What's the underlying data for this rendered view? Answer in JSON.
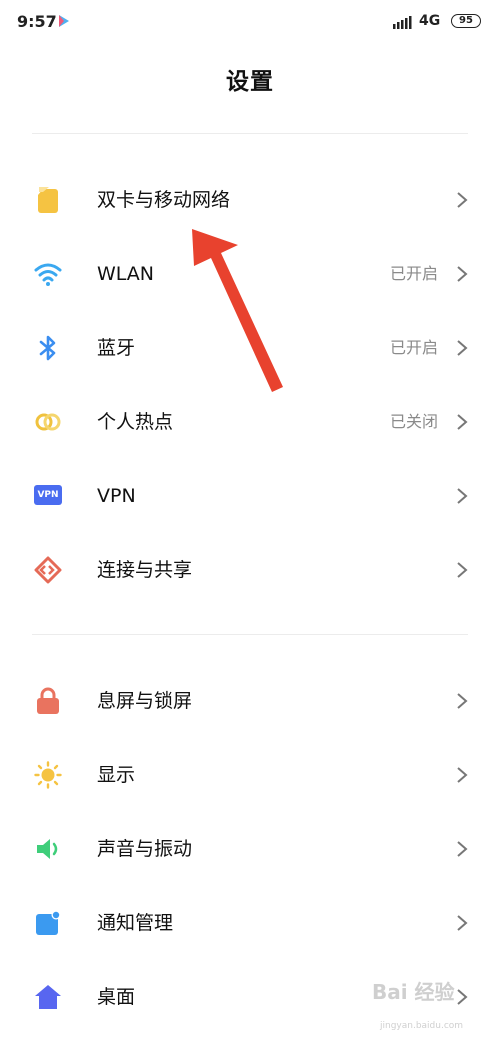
{
  "status_bar": {
    "time": "9:57",
    "network": "4G",
    "battery": "95"
  },
  "page_title": "设置",
  "section1": [
    {
      "label": "双卡与移动网络",
      "value": "",
      "icon": "sim-card-icon",
      "color": "#f5c342"
    },
    {
      "label": "WLAN",
      "value": "已开启",
      "icon": "wifi-icon",
      "color": "#3aa8f0"
    },
    {
      "label": "蓝牙",
      "value": "已开启",
      "icon": "bluetooth-icon",
      "color": "#3b8ef0"
    },
    {
      "label": "个人热点",
      "value": "已关闭",
      "icon": "hotspot-icon",
      "color": "#f0c23e"
    },
    {
      "label": "VPN",
      "value": "",
      "icon": "vpn-icon",
      "color": "#4a6cf0"
    },
    {
      "label": "连接与共享",
      "value": "",
      "icon": "connection-share-icon",
      "color": "#e56a57"
    }
  ],
  "section2": [
    {
      "label": "息屏与锁屏",
      "value": "",
      "icon": "lock-icon",
      "color": "#e9735f"
    },
    {
      "label": "显示",
      "value": "",
      "icon": "sun-icon",
      "color": "#f5c342"
    },
    {
      "label": "声音与振动",
      "value": "",
      "icon": "speaker-icon",
      "color": "#3fce7a"
    },
    {
      "label": "通知管理",
      "value": "",
      "icon": "notification-icon",
      "color": "#3b9af0"
    },
    {
      "label": "桌面",
      "value": "",
      "icon": "home-icon",
      "color": "#5866f0"
    }
  ],
  "vpn_badge_text": "VPN",
  "watermark": {
    "text": "Bai 经验",
    "sub": "jingyan.baidu.com"
  },
  "annotation_color": "#e8422e"
}
